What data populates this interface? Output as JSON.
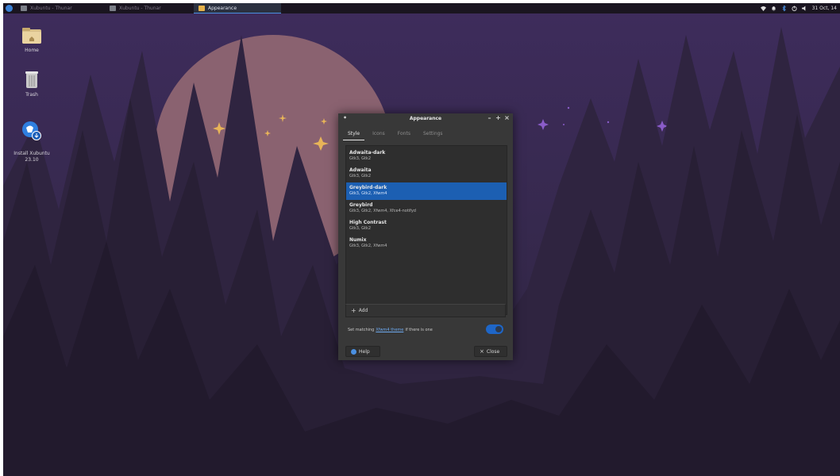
{
  "panel": {
    "tasks": [
      {
        "label": "Xubuntu - Thunar"
      },
      {
        "label": "Xubuntu - Thunar"
      },
      {
        "label": "Appearance"
      }
    ],
    "clock": "31 Oct, 14"
  },
  "desktop": {
    "icons": [
      {
        "label": "Home"
      },
      {
        "label": "Trash"
      },
      {
        "label": "Install Xubuntu\n23.10"
      }
    ]
  },
  "dialog": {
    "title": "Appearance",
    "tabs": [
      "Style",
      "Icons",
      "Fonts",
      "Settings"
    ],
    "active_tab": "Style",
    "themes": [
      {
        "name": "Adwaita-dark",
        "desc": "Gtk3, Gtk2"
      },
      {
        "name": "Adwaita",
        "desc": "Gtk3, Gtk2"
      },
      {
        "name": "Greybird-dark",
        "desc": "Gtk3, Gtk2, Xfwm4"
      },
      {
        "name": "Greybird",
        "desc": "Gtk3, Gtk2, Xfwm4, Xfce4-notifyd"
      },
      {
        "name": "High Contrast",
        "desc": "Gtk3, Gtk2"
      },
      {
        "name": "Numix",
        "desc": "Gtk3, Gtk2, Xfwm4"
      }
    ],
    "selected_theme": "Greybird-dark",
    "add_label": "Add",
    "match_text_before": "Set matching",
    "match_link": "Xfwm4 theme",
    "match_text_after": "if there is one",
    "toggle_on": true,
    "help_label": "Help",
    "close_label": "Close"
  },
  "colors": {
    "accent": "#1c5fb2",
    "sky": "#3a2a55",
    "moon": "#8a6270"
  }
}
